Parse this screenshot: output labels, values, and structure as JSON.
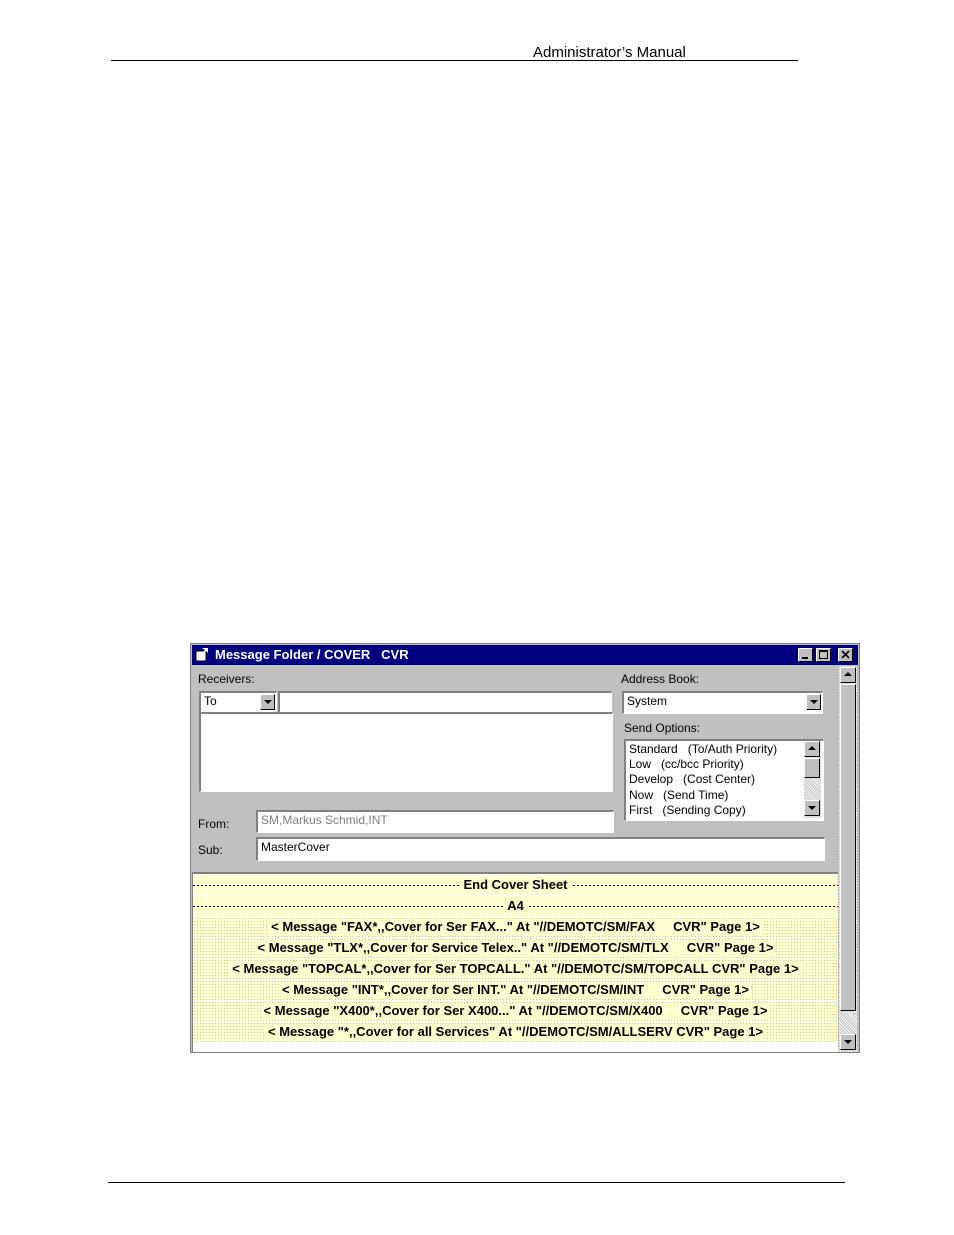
{
  "page": {
    "header_title": "Administrator’s Manual"
  },
  "window": {
    "title": "Message Folder / COVER   CVR",
    "receivers_label": "Receivers:",
    "receiver_type": "To",
    "receiver_value": "",
    "address_book_label": "Address Book:",
    "address_book_value": "System",
    "send_options_label": "Send Options:",
    "send_options": [
      "Standard   (To/Auth Priority)",
      "Low   (cc/bcc Priority)",
      "Develop   (Cost Center)",
      "Now   (Send Time)",
      "First   (Sending Copy)"
    ],
    "from_label": "From:",
    "from_value": "SM,Markus Schmid,INT",
    "sub_label": "Sub:",
    "sub_value": "MasterCover"
  },
  "cover_sheet": {
    "end_label": "End Cover Sheet",
    "paper_label": "A4",
    "messages": [
      "< Message \"FAX*,,Cover for Ser FAX...\" At \"//DEMOTC/SM/FAX     CVR\" Page 1>",
      "< Message \"TLX*,,Cover for Service Telex..\" At \"//DEMOTC/SM/TLX     CVR\" Page 1>",
      "< Message \"TOPCAL*,,Cover for Ser TOPCALL.\" At \"//DEMOTC/SM/TOPCALL CVR\" Page 1>",
      "< Message \"INT*,,Cover for Ser INT.\" At \"//DEMOTC/SM/INT     CVR\" Page 1>",
      "< Message \"X400*,,Cover for Ser X400...\" At \"//DEMOTC/SM/X400     CVR\" Page 1>",
      "< Message \"*,,Cover for all Services\" At \"//DEMOTC/SM/ALLSERV CVR\" Page 1>"
    ]
  },
  "colors": {
    "titlebar": "#000080",
    "window_face": "#c0c0c0",
    "cover_background": "#ffffd0"
  }
}
